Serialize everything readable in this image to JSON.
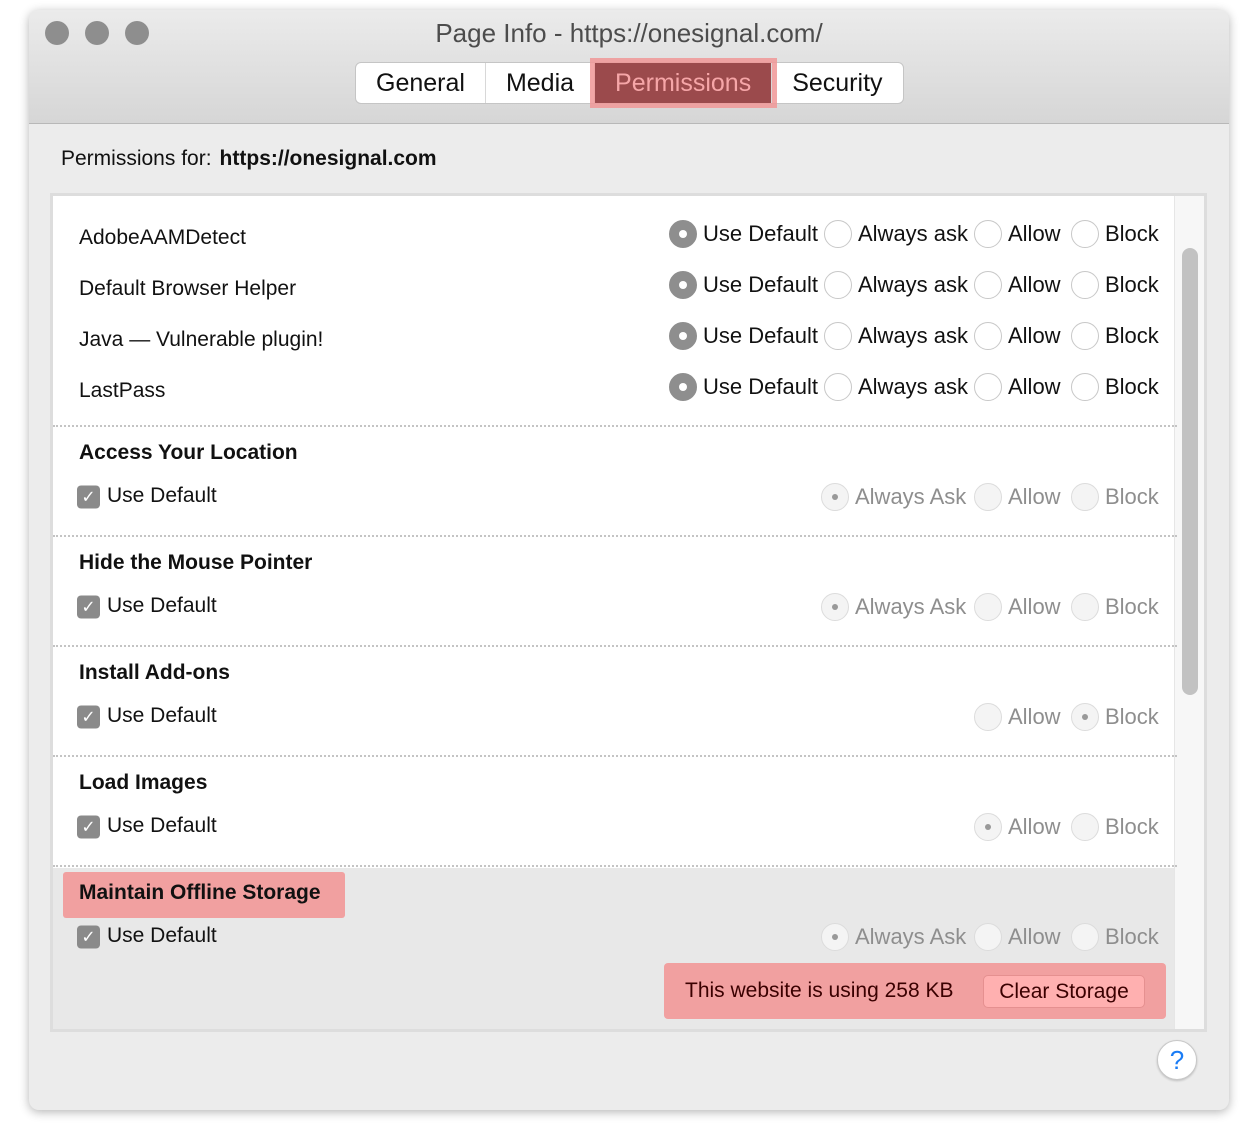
{
  "window": {
    "title": "Page Info - https://onesignal.com/"
  },
  "tabs": [
    {
      "label": "General"
    },
    {
      "label": "Media"
    },
    {
      "label": "Permissions",
      "active": true
    },
    {
      "label": "Security"
    }
  ],
  "permissions_for": {
    "label": "Permissions for:",
    "site": "https://onesignal.com"
  },
  "plugins": [
    {
      "name": "AdobeAAMDetect",
      "selected": "Use Default"
    },
    {
      "name": "Default Browser Helper",
      "selected": "Use Default"
    },
    {
      "name": "Java — Vulnerable plugin!",
      "selected": "Use Default"
    },
    {
      "name": "LastPass",
      "selected": "Use Default"
    }
  ],
  "plugin_options": [
    "Use Default",
    "Always ask",
    "Allow",
    "Block"
  ],
  "sections": [
    {
      "title": "Access Your Location",
      "use_default_label": "Use Default",
      "use_default": true,
      "options": [
        "Always Ask",
        "Allow",
        "Block"
      ],
      "selected": "Always Ask"
    },
    {
      "title": "Hide the Mouse Pointer",
      "use_default_label": "Use Default",
      "use_default": true,
      "options": [
        "Always Ask",
        "Allow",
        "Block"
      ],
      "selected": "Always Ask"
    },
    {
      "title": "Install Add-ons",
      "use_default_label": "Use Default",
      "use_default": true,
      "options": [
        "Allow",
        "Block"
      ],
      "selected": "Block"
    },
    {
      "title": "Load Images",
      "use_default_label": "Use Default",
      "use_default": true,
      "options": [
        "Allow",
        "Block"
      ],
      "selected": "Allow"
    },
    {
      "title": "Maintain Offline Storage",
      "use_default_label": "Use Default",
      "use_default": true,
      "options": [
        "Always Ask",
        "Allow",
        "Block"
      ],
      "selected": "Always Ask",
      "highlighted": true
    }
  ],
  "storage": {
    "text": "This website is using 258 KB",
    "clear_label": "Clear Storage"
  },
  "help": {
    "label": "?"
  },
  "colors": {
    "highlight": "#f1a0a0",
    "active_tab": "#9b4a4c",
    "help_icon": "#1a7cf5"
  }
}
